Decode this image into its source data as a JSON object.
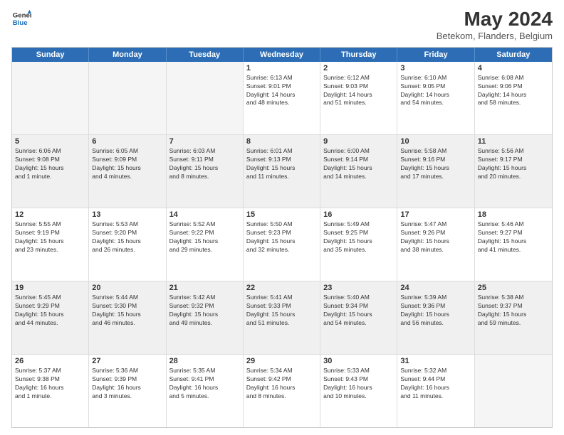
{
  "header": {
    "logo_line1": "General",
    "logo_line2": "Blue",
    "title": "May 2024",
    "subtitle": "Betekom, Flanders, Belgium"
  },
  "days": [
    "Sunday",
    "Monday",
    "Tuesday",
    "Wednesday",
    "Thursday",
    "Friday",
    "Saturday"
  ],
  "weeks": [
    [
      {
        "date": "",
        "info": "",
        "empty": true
      },
      {
        "date": "",
        "info": "",
        "empty": true
      },
      {
        "date": "",
        "info": "",
        "empty": true
      },
      {
        "date": "1",
        "info": "Sunrise: 6:13 AM\nSunset: 9:01 PM\nDaylight: 14 hours\nand 48 minutes.",
        "empty": false
      },
      {
        "date": "2",
        "info": "Sunrise: 6:12 AM\nSunset: 9:03 PM\nDaylight: 14 hours\nand 51 minutes.",
        "empty": false
      },
      {
        "date": "3",
        "info": "Sunrise: 6:10 AM\nSunset: 9:05 PM\nDaylight: 14 hours\nand 54 minutes.",
        "empty": false
      },
      {
        "date": "4",
        "info": "Sunrise: 6:08 AM\nSunset: 9:06 PM\nDaylight: 14 hours\nand 58 minutes.",
        "empty": false
      }
    ],
    [
      {
        "date": "5",
        "info": "Sunrise: 6:06 AM\nSunset: 9:08 PM\nDaylight: 15 hours\nand 1 minute.",
        "empty": false
      },
      {
        "date": "6",
        "info": "Sunrise: 6:05 AM\nSunset: 9:09 PM\nDaylight: 15 hours\nand 4 minutes.",
        "empty": false
      },
      {
        "date": "7",
        "info": "Sunrise: 6:03 AM\nSunset: 9:11 PM\nDaylight: 15 hours\nand 8 minutes.",
        "empty": false
      },
      {
        "date": "8",
        "info": "Sunrise: 6:01 AM\nSunset: 9:13 PM\nDaylight: 15 hours\nand 11 minutes.",
        "empty": false
      },
      {
        "date": "9",
        "info": "Sunrise: 6:00 AM\nSunset: 9:14 PM\nDaylight: 15 hours\nand 14 minutes.",
        "empty": false
      },
      {
        "date": "10",
        "info": "Sunrise: 5:58 AM\nSunset: 9:16 PM\nDaylight: 15 hours\nand 17 minutes.",
        "empty": false
      },
      {
        "date": "11",
        "info": "Sunrise: 5:56 AM\nSunset: 9:17 PM\nDaylight: 15 hours\nand 20 minutes.",
        "empty": false
      }
    ],
    [
      {
        "date": "12",
        "info": "Sunrise: 5:55 AM\nSunset: 9:19 PM\nDaylight: 15 hours\nand 23 minutes.",
        "empty": false
      },
      {
        "date": "13",
        "info": "Sunrise: 5:53 AM\nSunset: 9:20 PM\nDaylight: 15 hours\nand 26 minutes.",
        "empty": false
      },
      {
        "date": "14",
        "info": "Sunrise: 5:52 AM\nSunset: 9:22 PM\nDaylight: 15 hours\nand 29 minutes.",
        "empty": false
      },
      {
        "date": "15",
        "info": "Sunrise: 5:50 AM\nSunset: 9:23 PM\nDaylight: 15 hours\nand 32 minutes.",
        "empty": false
      },
      {
        "date": "16",
        "info": "Sunrise: 5:49 AM\nSunset: 9:25 PM\nDaylight: 15 hours\nand 35 minutes.",
        "empty": false
      },
      {
        "date": "17",
        "info": "Sunrise: 5:47 AM\nSunset: 9:26 PM\nDaylight: 15 hours\nand 38 minutes.",
        "empty": false
      },
      {
        "date": "18",
        "info": "Sunrise: 5:46 AM\nSunset: 9:27 PM\nDaylight: 15 hours\nand 41 minutes.",
        "empty": false
      }
    ],
    [
      {
        "date": "19",
        "info": "Sunrise: 5:45 AM\nSunset: 9:29 PM\nDaylight: 15 hours\nand 44 minutes.",
        "empty": false
      },
      {
        "date": "20",
        "info": "Sunrise: 5:44 AM\nSunset: 9:30 PM\nDaylight: 15 hours\nand 46 minutes.",
        "empty": false
      },
      {
        "date": "21",
        "info": "Sunrise: 5:42 AM\nSunset: 9:32 PM\nDaylight: 15 hours\nand 49 minutes.",
        "empty": false
      },
      {
        "date": "22",
        "info": "Sunrise: 5:41 AM\nSunset: 9:33 PM\nDaylight: 15 hours\nand 51 minutes.",
        "empty": false
      },
      {
        "date": "23",
        "info": "Sunrise: 5:40 AM\nSunset: 9:34 PM\nDaylight: 15 hours\nand 54 minutes.",
        "empty": false
      },
      {
        "date": "24",
        "info": "Sunrise: 5:39 AM\nSunset: 9:36 PM\nDaylight: 15 hours\nand 56 minutes.",
        "empty": false
      },
      {
        "date": "25",
        "info": "Sunrise: 5:38 AM\nSunset: 9:37 PM\nDaylight: 15 hours\nand 59 minutes.",
        "empty": false
      }
    ],
    [
      {
        "date": "26",
        "info": "Sunrise: 5:37 AM\nSunset: 9:38 PM\nDaylight: 16 hours\nand 1 minute.",
        "empty": false
      },
      {
        "date": "27",
        "info": "Sunrise: 5:36 AM\nSunset: 9:39 PM\nDaylight: 16 hours\nand 3 minutes.",
        "empty": false
      },
      {
        "date": "28",
        "info": "Sunrise: 5:35 AM\nSunset: 9:41 PM\nDaylight: 16 hours\nand 5 minutes.",
        "empty": false
      },
      {
        "date": "29",
        "info": "Sunrise: 5:34 AM\nSunset: 9:42 PM\nDaylight: 16 hours\nand 8 minutes.",
        "empty": false
      },
      {
        "date": "30",
        "info": "Sunrise: 5:33 AM\nSunset: 9:43 PM\nDaylight: 16 hours\nand 10 minutes.",
        "empty": false
      },
      {
        "date": "31",
        "info": "Sunrise: 5:32 AM\nSunset: 9:44 PM\nDaylight: 16 hours\nand 11 minutes.",
        "empty": false
      },
      {
        "date": "",
        "info": "",
        "empty": true
      }
    ]
  ]
}
